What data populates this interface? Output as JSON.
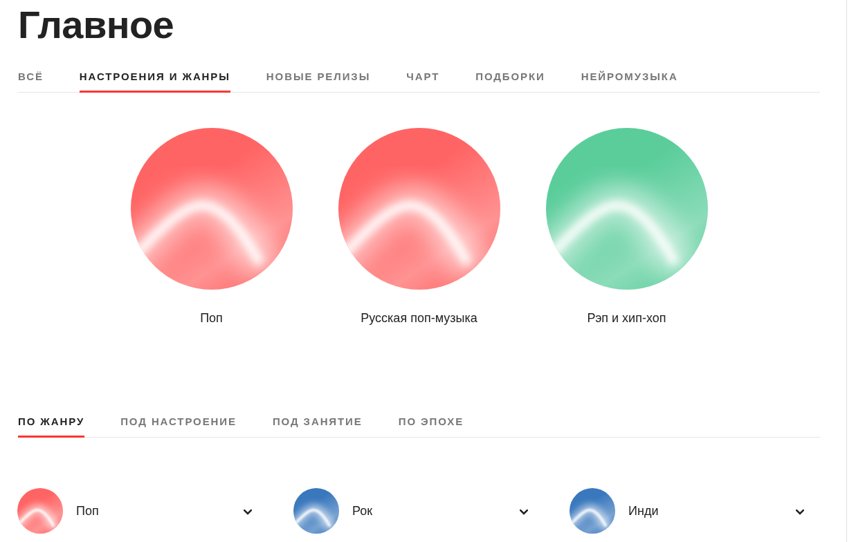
{
  "title": "Главное",
  "tabs": [
    {
      "label": "ВСЁ",
      "selected": false
    },
    {
      "label": "НАСТРОЕНИЯ И ЖАНРЫ",
      "selected": true
    },
    {
      "label": "НОВЫЕ РЕЛИЗЫ",
      "selected": false
    },
    {
      "label": "ЧАРТ",
      "selected": false
    },
    {
      "label": "ПОДБОРКИ",
      "selected": false
    },
    {
      "label": "НЕЙРОМУЗЫКА",
      "selected": false
    }
  ],
  "featured_genres": [
    {
      "name": "Поп",
      "color": "#ff6464"
    },
    {
      "name": "Русская поп-музыка",
      "color": "#ff6464"
    },
    {
      "name": "Рэп и хип-хоп",
      "color": "#5acd9b"
    }
  ],
  "subtabs": [
    {
      "label": "ПО ЖАНРУ",
      "selected": true
    },
    {
      "label": "ПОД НАСТРОЕНИЕ",
      "selected": false
    },
    {
      "label": "ПОД ЗАНЯТИЕ",
      "selected": false
    },
    {
      "label": "ПО ЭПОХЕ",
      "selected": false
    }
  ],
  "genre_list": [
    {
      "name": "Поп",
      "color": "#ff6464",
      "expanded": false
    },
    {
      "name": "Рок",
      "color": "#3a78bd",
      "expanded": false
    },
    {
      "name": "Инди",
      "color": "#3a78bd",
      "expanded": false
    }
  ]
}
